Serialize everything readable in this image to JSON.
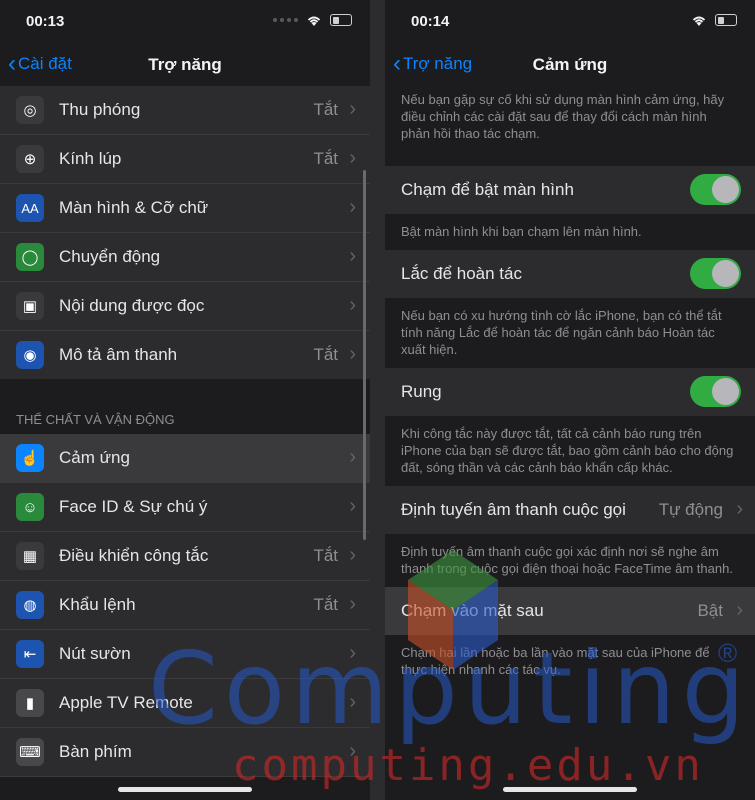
{
  "left": {
    "status": {
      "time": "00:13"
    },
    "nav": {
      "back_label": "Cài đặt",
      "title": "Trợ năng"
    },
    "rows_top": [
      {
        "label": "Thu phóng",
        "value": "Tắt",
        "icon": "zoom-icon"
      },
      {
        "label": "Kính lúp",
        "value": "Tắt",
        "icon": "magnifier-icon"
      },
      {
        "label": "Màn hình & Cỡ chữ",
        "value": "",
        "icon": "text-size-icon"
      },
      {
        "label": "Chuyển động",
        "value": "",
        "icon": "motion-icon"
      },
      {
        "label": "Nội dung được đọc",
        "value": "",
        "icon": "speech-icon"
      },
      {
        "label": "Mô tả âm thanh",
        "value": "Tắt",
        "icon": "audio-description-icon"
      }
    ],
    "section_header": "THỂ CHẤT VÀ VẬN ĐỘNG",
    "rows_bottom": [
      {
        "label": "Cảm ứng",
        "value": "",
        "icon": "touch-icon"
      },
      {
        "label": "Face ID & Sự chú ý",
        "value": "",
        "icon": "face-id-icon"
      },
      {
        "label": "Điều khiển công tắc",
        "value": "Tắt",
        "icon": "switch-control-icon"
      },
      {
        "label": "Khẩu lệnh",
        "value": "Tắt",
        "icon": "voice-control-icon"
      },
      {
        "label": "Nút sườn",
        "value": "",
        "icon": "side-button-icon"
      },
      {
        "label": "Apple TV Remote",
        "value": "",
        "icon": "tv-remote-icon"
      },
      {
        "label": "Bàn phím",
        "value": "",
        "icon": "keyboard-icon"
      }
    ]
  },
  "right": {
    "status": {
      "time": "00:14"
    },
    "nav": {
      "back_label": "Trợ năng",
      "title": "Cảm ứng"
    },
    "intro": "Nếu bạn gặp sự cố khi sử dụng màn hình cảm ứng, hãy điều chỉnh các cài đặt sau để thay đổi cách màn hình phản hồi thao tác chạm.",
    "tap_to_wake": {
      "label": "Chạm để bật màn hình",
      "on": true,
      "footer": "Bật màn hình khi bạn chạm lên màn hình."
    },
    "shake_to_undo": {
      "label": "Lắc để hoàn tác",
      "on": true,
      "footer": "Nếu bạn có xu hướng tình cờ lắc iPhone, bạn có thể tắt tính năng Lắc để hoàn tác để ngăn cảnh báo Hoàn tác xuất hiện."
    },
    "vibration": {
      "label": "Rung",
      "on": true,
      "footer": "Khi công tắc này được tắt, tất cả cảnh báo rung trên iPhone của bạn sẽ được tắt, bao gồm cảnh báo cho động đất, sóng thần và các cảnh báo khẩn cấp khác."
    },
    "call_audio": {
      "label": "Định tuyến âm thanh cuộc gọi",
      "value": "Tự động",
      "footer": "Định tuyến âm thanh cuộc gọi xác định nơi sẽ nghe âm thanh trong cuộc gọi điện thoại hoặc FaceTime âm thanh."
    },
    "back_tap": {
      "label": "Chạm vào mặt sau",
      "value": "Bật",
      "footer": "Chạm hai lần hoặc ba lần vào mặt sau của iPhone để thực hiện nhanh các tác vụ."
    }
  },
  "watermark": {
    "brand": "Computing",
    "reg": "®",
    "site": "computing.edu.vn"
  },
  "colors": {
    "accent": "#0a84ff",
    "toggle_on": "#32d74b",
    "background": "#1c1c1e",
    "cell": "#2c2c2e"
  }
}
